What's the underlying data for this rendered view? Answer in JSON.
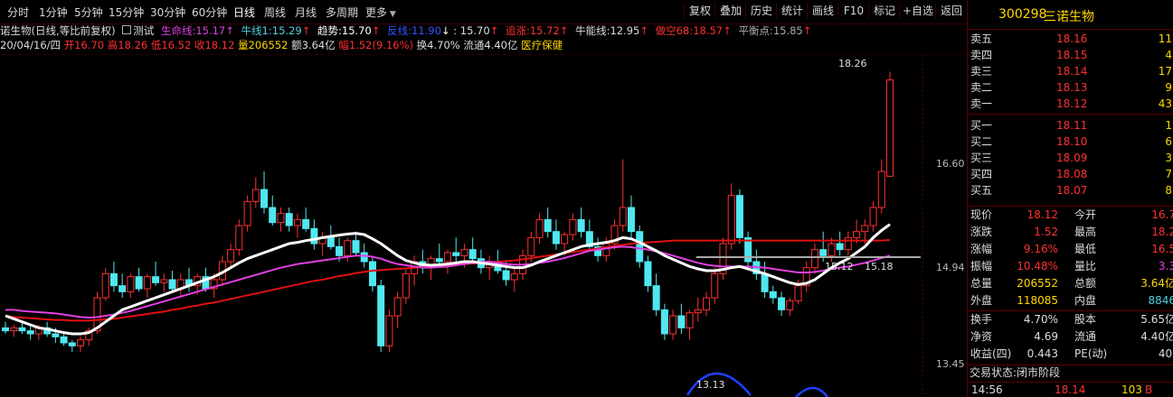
{
  "periods": [
    {
      "label": "分时"
    },
    {
      "label": "1分钟"
    },
    {
      "label": "5分钟"
    },
    {
      "label": "15分钟"
    },
    {
      "label": "30分钟"
    },
    {
      "label": "60分钟"
    },
    {
      "label": "日线",
      "active": true
    },
    {
      "label": "周线"
    },
    {
      "label": "月线"
    },
    {
      "label": "多周期"
    },
    {
      "label": "更多"
    }
  ],
  "tools": [
    "复权",
    "叠加",
    "历史",
    "统计",
    "画线",
    "F10",
    "标记",
    "+自选",
    "返回"
  ],
  "indicator_line": {
    "name": "诺生物(日线,等比前复权)",
    "test": "测试",
    "life_label": "生命线:",
    "life_value": "15.17",
    "bull_label": "牛线1:",
    "bull_value": "15.29",
    "trend_label": "趋势:",
    "trend_value": "15.70",
    "reverse_label": "反线:",
    "reverse_value": "11.90",
    "extra_value": ": 15.70",
    "chase_label": "追涨:",
    "chase_value": "15.72",
    "bullcap_label": "牛能线:",
    "bullcap_value": "12.95",
    "short_label": "做空68:",
    "short_value": "18.57",
    "balance_label": "平衡点:",
    "balance_value": "15.85"
  },
  "ohlc_line": {
    "date": "20/04/16/四",
    "open": "开16.70",
    "high": "高18.26",
    "low": "低16.52",
    "close": "收18.12",
    "vol": "量206552",
    "amt": "额3.64亿",
    "amp": "幅1.52(9.16%)",
    "turn": "换4.70%",
    "float": "流通4.40亿",
    "sector": "医疗保健"
  },
  "axis_labels": {
    "a": "16.60",
    "b": "14.94",
    "c": "13.45"
  },
  "chart_annotations": {
    "high": "18.26",
    "low": "13.13",
    "mark1": "15.18",
    "mark2": "15.12"
  },
  "chart_data": {
    "type": "candlestick",
    "ylim": [
      13.0,
      18.4
    ],
    "candles": [
      [
        14.0,
        14.1,
        13.9,
        13.95
      ],
      [
        13.95,
        14.05,
        13.85,
        14.0
      ],
      [
        14.0,
        14.1,
        13.9,
        13.95
      ],
      [
        13.95,
        14.05,
        13.8,
        13.9
      ],
      [
        13.9,
        14.05,
        13.8,
        14.0
      ],
      [
        14.0,
        14.1,
        13.85,
        13.9
      ],
      [
        13.9,
        14.0,
        13.75,
        13.85
      ],
      [
        13.85,
        13.9,
        13.7,
        13.75
      ],
      [
        13.75,
        13.8,
        13.6,
        13.7
      ],
      [
        13.7,
        13.85,
        13.6,
        13.8
      ],
      [
        13.8,
        14.0,
        13.7,
        13.95
      ],
      [
        13.95,
        14.6,
        13.9,
        14.5
      ],
      [
        14.5,
        15.0,
        14.45,
        14.9
      ],
      [
        14.9,
        15.1,
        14.6,
        14.7
      ],
      [
        14.7,
        14.9,
        14.5,
        14.6
      ],
      [
        14.6,
        14.9,
        14.5,
        14.85
      ],
      [
        14.85,
        15.0,
        14.6,
        14.65
      ],
      [
        14.65,
        14.9,
        14.5,
        14.85
      ],
      [
        14.85,
        15.1,
        14.7,
        14.75
      ],
      [
        14.75,
        14.9,
        14.6,
        14.8
      ],
      [
        14.8,
        14.95,
        14.6,
        14.65
      ],
      [
        14.65,
        14.9,
        14.5,
        14.8
      ],
      [
        14.8,
        15.0,
        14.6,
        14.7
      ],
      [
        14.7,
        14.9,
        14.55,
        14.85
      ],
      [
        14.85,
        15.0,
        14.6,
        14.65
      ],
      [
        14.65,
        14.9,
        14.5,
        14.8
      ],
      [
        14.8,
        15.2,
        14.7,
        15.1
      ],
      [
        15.1,
        15.4,
        15.0,
        15.3
      ],
      [
        15.3,
        15.8,
        15.2,
        15.7
      ],
      [
        15.7,
        16.2,
        15.6,
        16.1
      ],
      [
        16.1,
        16.5,
        16.0,
        16.3
      ],
      [
        16.3,
        16.6,
        15.9,
        16.0
      ],
      [
        16.0,
        16.2,
        15.7,
        15.75
      ],
      [
        15.75,
        16.0,
        15.6,
        15.9
      ],
      [
        15.9,
        16.0,
        15.6,
        15.7
      ],
      [
        15.7,
        15.9,
        15.5,
        15.8
      ],
      [
        15.8,
        16.0,
        15.6,
        15.65
      ],
      [
        15.65,
        15.8,
        15.3,
        15.4
      ],
      [
        15.4,
        15.6,
        15.2,
        15.5
      ],
      [
        15.5,
        15.7,
        15.3,
        15.35
      ],
      [
        15.35,
        15.5,
        15.1,
        15.2
      ],
      [
        15.2,
        15.5,
        15.1,
        15.45
      ],
      [
        15.45,
        15.6,
        15.2,
        15.25
      ],
      [
        15.25,
        15.4,
        15.0,
        15.1
      ],
      [
        15.1,
        15.2,
        14.6,
        14.7
      ],
      [
        14.7,
        14.8,
        13.6,
        13.7
      ],
      [
        13.7,
        14.3,
        13.6,
        14.2
      ],
      [
        14.2,
        14.6,
        14.0,
        14.5
      ],
      [
        14.5,
        15.0,
        14.4,
        14.9
      ],
      [
        14.9,
        15.2,
        14.7,
        15.1
      ],
      [
        15.1,
        15.3,
        14.9,
        15.0
      ],
      [
        15.0,
        15.2,
        14.8,
        15.15
      ],
      [
        15.15,
        15.4,
        15.0,
        15.1
      ],
      [
        15.1,
        15.3,
        14.9,
        15.25
      ],
      [
        15.25,
        15.5,
        15.1,
        15.2
      ],
      [
        15.2,
        15.4,
        15.0,
        15.3
      ],
      [
        15.3,
        15.5,
        15.1,
        15.15
      ],
      [
        15.15,
        15.3,
        14.9,
        15.0
      ],
      [
        15.0,
        15.2,
        14.8,
        15.1
      ],
      [
        15.1,
        15.3,
        14.9,
        14.95
      ],
      [
        14.95,
        15.1,
        14.7,
        14.8
      ],
      [
        14.8,
        15.0,
        14.6,
        14.9
      ],
      [
        14.9,
        15.3,
        14.8,
        15.2
      ],
      [
        15.2,
        15.6,
        15.1,
        15.5
      ],
      [
        15.5,
        15.9,
        15.4,
        15.8
      ],
      [
        15.8,
        16.0,
        15.5,
        15.6
      ],
      [
        15.6,
        15.8,
        15.3,
        15.4
      ],
      [
        15.4,
        15.6,
        15.2,
        15.55
      ],
      [
        15.55,
        15.9,
        15.45,
        15.8
      ],
      [
        15.8,
        16.0,
        15.5,
        15.6
      ],
      [
        15.6,
        15.8,
        15.3,
        15.35
      ],
      [
        15.35,
        15.5,
        15.1,
        15.2
      ],
      [
        15.2,
        15.5,
        15.1,
        15.4
      ],
      [
        15.4,
        15.8,
        15.3,
        15.7
      ],
      [
        15.7,
        16.8,
        15.6,
        16.0
      ],
      [
        16.0,
        16.2,
        15.5,
        15.6
      ],
      [
        15.6,
        15.7,
        15.0,
        15.1
      ],
      [
        15.1,
        15.2,
        14.6,
        14.7
      ],
      [
        14.7,
        14.9,
        14.2,
        14.3
      ],
      [
        14.3,
        14.4,
        13.8,
        13.9
      ],
      [
        13.9,
        14.3,
        13.8,
        14.2
      ],
      [
        14.2,
        14.4,
        13.9,
        14.0
      ],
      [
        14.0,
        14.3,
        13.8,
        14.25
      ],
      [
        14.25,
        14.5,
        14.1,
        14.3
      ],
      [
        14.3,
        14.6,
        14.2,
        14.5
      ],
      [
        14.5,
        15.0,
        14.4,
        14.9
      ],
      [
        14.9,
        15.5,
        14.8,
        15.4
      ],
      [
        15.4,
        16.4,
        15.3,
        16.2
      ],
      [
        16.2,
        16.3,
        15.4,
        15.5
      ],
      [
        15.5,
        15.6,
        15.0,
        15.1
      ],
      [
        15.1,
        15.3,
        14.8,
        14.9
      ],
      [
        14.9,
        15.1,
        14.5,
        14.6
      ],
      [
        14.6,
        14.7,
        14.4,
        14.5
      ],
      [
        14.5,
        14.6,
        14.2,
        14.3
      ],
      [
        14.3,
        14.5,
        14.2,
        14.45
      ],
      [
        14.45,
        14.8,
        14.4,
        14.7
      ],
      [
        14.7,
        15.1,
        14.6,
        15.0
      ],
      [
        15.0,
        15.4,
        14.9,
        15.3
      ],
      [
        15.3,
        15.6,
        15.1,
        15.2
      ],
      [
        15.2,
        15.5,
        15.1,
        15.4
      ],
      [
        15.4,
        15.6,
        15.2,
        15.3
      ],
      [
        15.3,
        15.6,
        15.2,
        15.5
      ],
      [
        15.5,
        15.8,
        15.4,
        15.6
      ],
      [
        15.6,
        15.8,
        15.4,
        15.7
      ],
      [
        15.7,
        16.1,
        15.6,
        16.0
      ],
      [
        16.0,
        16.8,
        15.9,
        16.6
      ],
      [
        16.52,
        18.26,
        16.52,
        18.12
      ]
    ],
    "ma_white": [
      14.2,
      14.15,
      14.1,
      14.05,
      14.0,
      13.98,
      13.95,
      13.92,
      13.9,
      13.9,
      13.92,
      14.0,
      14.1,
      14.2,
      14.3,
      14.35,
      14.4,
      14.45,
      14.5,
      14.55,
      14.6,
      14.65,
      14.7,
      14.75,
      14.8,
      14.85,
      14.92,
      15.0,
      15.08,
      15.15,
      15.2,
      15.25,
      15.3,
      15.35,
      15.4,
      15.42,
      15.45,
      15.47,
      15.5,
      15.52,
      15.54,
      15.56,
      15.57,
      15.55,
      15.48,
      15.4,
      15.3,
      15.2,
      15.12,
      15.08,
      15.05,
      15.04,
      15.05,
      15.06,
      15.08,
      15.1,
      15.1,
      15.08,
      15.06,
      15.04,
      15.02,
      15.0,
      15.0,
      15.04,
      15.1,
      15.15,
      15.2,
      15.25,
      15.3,
      15.35,
      15.38,
      15.4,
      15.42,
      15.45,
      15.5,
      15.48,
      15.42,
      15.35,
      15.28,
      15.2,
      15.14,
      15.08,
      15.02,
      14.98,
      14.95,
      14.95,
      14.97,
      15.0,
      15.02,
      14.98,
      14.94,
      14.9,
      14.85,
      14.8,
      14.75,
      14.72,
      14.74,
      14.8,
      14.9,
      15.0,
      15.08,
      15.15,
      15.25,
      15.35,
      15.5,
      15.62,
      15.72
    ],
    "ma_magenta": [
      14.3,
      14.3,
      14.28,
      14.27,
      14.26,
      14.25,
      14.24,
      14.22,
      14.2,
      14.18,
      14.17,
      14.18,
      14.2,
      14.22,
      14.25,
      14.28,
      14.32,
      14.36,
      14.4,
      14.44,
      14.48,
      14.52,
      14.56,
      14.6,
      14.64,
      14.68,
      14.72,
      14.76,
      14.8,
      14.84,
      14.88,
      14.92,
      14.96,
      15.0,
      15.03,
      15.06,
      15.08,
      15.1,
      15.12,
      15.14,
      15.16,
      15.18,
      15.2,
      15.2,
      15.18,
      15.15,
      15.1,
      15.06,
      15.04,
      15.02,
      15.0,
      15.0,
      15.01,
      15.02,
      15.04,
      15.06,
      15.08,
      15.1,
      15.1,
      15.08,
      15.06,
      15.05,
      15.05,
      15.06,
      15.08,
      15.1,
      15.13,
      15.16,
      15.2,
      15.24,
      15.28,
      15.3,
      15.32,
      15.34,
      15.35,
      15.34,
      15.32,
      15.3,
      15.27,
      15.24,
      15.2,
      15.16,
      15.12,
      15.08,
      15.05,
      15.03,
      15.02,
      15.02,
      15.02,
      15.02,
      15.01,
      15.0,
      14.98,
      14.96,
      14.94,
      14.92,
      14.92,
      14.93,
      14.95,
      14.98,
      15.0,
      15.02,
      15.05,
      15.08,
      15.12,
      15.16,
      15.2
    ],
    "ma_red": [
      14.2,
      14.18,
      14.17,
      14.16,
      14.15,
      14.14,
      14.13,
      14.13,
      14.12,
      14.12,
      14.12,
      14.13,
      14.14,
      14.15,
      14.17,
      14.19,
      14.21,
      14.23,
      14.25,
      14.27,
      14.3,
      14.32,
      14.35,
      14.37,
      14.4,
      14.42,
      14.45,
      14.48,
      14.51,
      14.54,
      14.57,
      14.6,
      14.63,
      14.66,
      14.69,
      14.72,
      14.75,
      14.78,
      14.8,
      14.83,
      14.86,
      14.88,
      14.91,
      14.93,
      14.95,
      14.96,
      14.97,
      14.98,
      14.99,
      15.0,
      15.01,
      15.02,
      15.03,
      15.04,
      15.05,
      15.06,
      15.07,
      15.08,
      15.09,
      15.1,
      15.11,
      15.12,
      15.14,
      15.16,
      15.18,
      15.2,
      15.22,
      15.24,
      15.26,
      15.28,
      15.3,
      15.32,
      15.34,
      15.36,
      15.38,
      15.4,
      15.41,
      15.42,
      15.43,
      15.44,
      15.45,
      15.45,
      15.45,
      15.45,
      15.45,
      15.45,
      15.45,
      15.45,
      15.45,
      15.45,
      15.45,
      15.45,
      15.45,
      15.45,
      15.45,
      15.45,
      15.45,
      15.45,
      15.45,
      15.45,
      15.45,
      15.45,
      15.45,
      15.45,
      15.45,
      15.45,
      15.46
    ]
  },
  "quote_panel": {
    "code": "300298",
    "name": "三诺生物",
    "sells": [
      {
        "label": "卖五",
        "price": "18.16",
        "vol": "11"
      },
      {
        "label": "卖四",
        "price": "18.15",
        "vol": "4"
      },
      {
        "label": "卖三",
        "price": "18.14",
        "vol": "17"
      },
      {
        "label": "卖二",
        "price": "18.13",
        "vol": "9"
      },
      {
        "label": "卖一",
        "price": "18.12",
        "vol": "43"
      }
    ],
    "buys": [
      {
        "label": "买一",
        "price": "18.11",
        "vol": "1"
      },
      {
        "label": "买二",
        "price": "18.10",
        "vol": "6"
      },
      {
        "label": "买三",
        "price": "18.09",
        "vol": "3"
      },
      {
        "label": "买四",
        "price": "18.08",
        "vol": "7"
      },
      {
        "label": "买五",
        "price": "18.07",
        "vol": "8"
      }
    ],
    "stats": [
      {
        "l1": "现价",
        "v1": "18.12",
        "l2": "今开",
        "v2": "16.7"
      },
      {
        "l1": "涨跌",
        "v1": "1.52",
        "l2": "最高",
        "v2": "18.2"
      },
      {
        "l1": "涨幅",
        "v1": "9.16%",
        "l2": "最低",
        "v2": "16.5"
      },
      {
        "l1": "振幅",
        "v1": "10.48%",
        "l2": "量比",
        "v2": "3.3"
      },
      {
        "l1": "总量",
        "v1": "206552",
        "l2": "总额",
        "v2": "3.64亿"
      },
      {
        "l1": "外盘",
        "v1": "118085",
        "l2": "内盘",
        "v2": "8846"
      }
    ],
    "stats2": [
      {
        "l1": "换手",
        "v1": "4.70%",
        "l2": "股本",
        "v2": "5.65亿"
      },
      {
        "l1": "净资",
        "v1": "4.69",
        "l2": "流通",
        "v2": "4.40亿"
      },
      {
        "l1": "收益(四)",
        "v1": "0.443",
        "l2": "PE(动)",
        "v2": "40."
      }
    ],
    "trade_status": "交易状态:闭市阶段",
    "tick": {
      "time": "14:56",
      "price": "18.14",
      "vol": "103",
      "side": "B"
    }
  }
}
